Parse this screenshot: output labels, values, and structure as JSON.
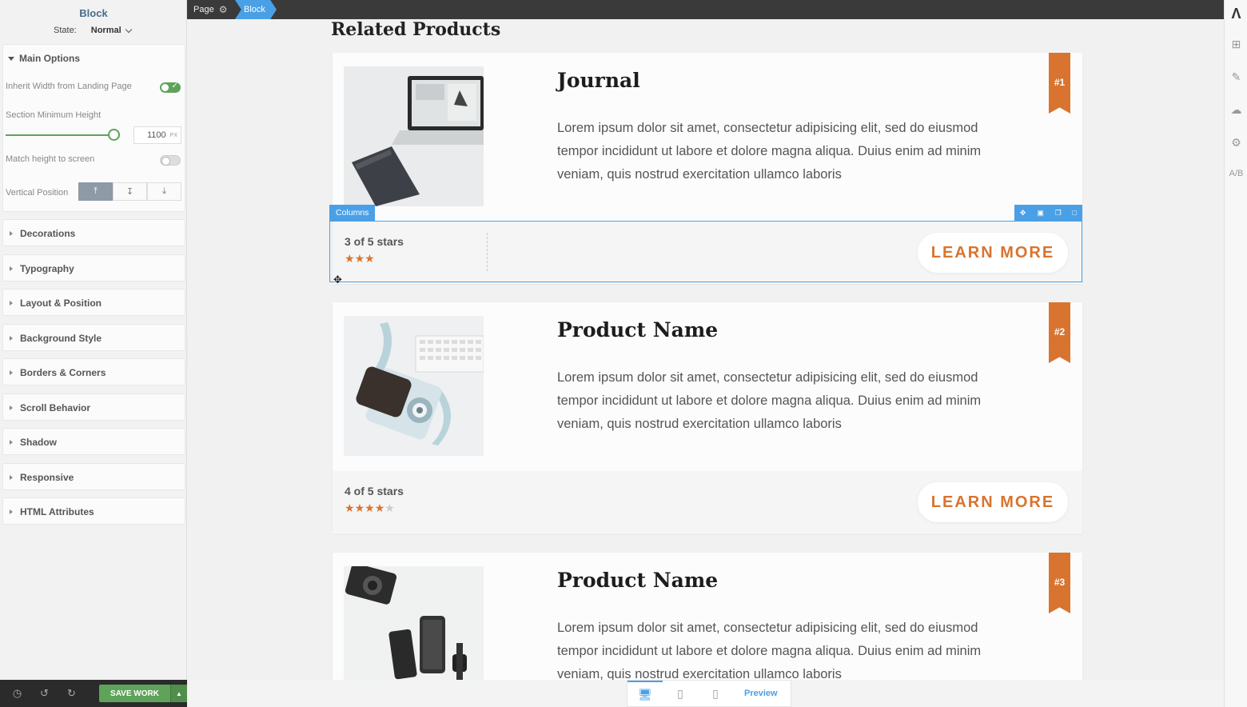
{
  "sidebar": {
    "title": "Block",
    "state_label": "State:",
    "state_value": "Normal",
    "main_options": {
      "label": "Main Options",
      "inherit_width_label": "Inherit Width from Landing Page",
      "inherit_width_on": true,
      "min_height_label": "Section Minimum Height",
      "min_height_value": "1100",
      "min_height_unit": "PX",
      "match_height_label": "Match height to screen",
      "match_height_on": false,
      "vertical_position_label": "Vertical Position",
      "vertical_positions": [
        "⤒",
        "↧",
        "⤓"
      ]
    },
    "sections": [
      "Decorations",
      "Typography",
      "Layout & Position",
      "Background Style",
      "Borders & Corners",
      "Scroll Behavior",
      "Shadow",
      "Responsive",
      "HTML Attributes"
    ],
    "footer": {
      "save_label": "SAVE WORK",
      "icons": [
        "history-icon",
        "undo-icon",
        "redo-icon"
      ]
    }
  },
  "topbar": {
    "crumbs": [
      "Page",
      "Block"
    ]
  },
  "canvas": {
    "heading": "Related Products",
    "selection_label": "Columns",
    "products": [
      {
        "name": "Journal",
        "rank": "#1",
        "description": "Lorem ipsum dolor sit amet, consectetur adipisicing elit, sed do eiusmod tempor incididunt ut labore et dolore magna aliqua. Duius enim ad minim veniam, quis nostrud exercitation ullamco laboris",
        "rating_text": "3 of 5 stars",
        "rating": 3,
        "button": "LEARN MORE"
      },
      {
        "name": "Product Name",
        "rank": "#2",
        "description": "Lorem ipsum dolor sit amet, consectetur adipisicing elit, sed do eiusmod tempor incididunt ut labore et dolore magna aliqua. Duius enim ad minim veniam, quis nostrud exercitation ullamco laboris",
        "rating_text": "4 of 5 stars",
        "rating": 4,
        "button": "LEARN MORE"
      },
      {
        "name": "Product Name",
        "rank": "#3",
        "description": "Lorem ipsum dolor sit amet, consectetur adipisicing elit, sed do eiusmod tempor incididunt ut labore et dolore magna aliqua. Duius enim ad minim veniam, quis nostrud exercitation ullamco laboris",
        "rating_text": "",
        "rating": null,
        "button": ""
      }
    ]
  },
  "device_bar": {
    "preview_label": "Preview",
    "devices": [
      "desktop-icon",
      "tablet-icon",
      "mobile-icon"
    ],
    "active": "desktop-icon"
  },
  "colors": {
    "accent": "#4aa0e6",
    "brand_orange": "#d8742f",
    "toggle_green": "#5fa35a"
  }
}
